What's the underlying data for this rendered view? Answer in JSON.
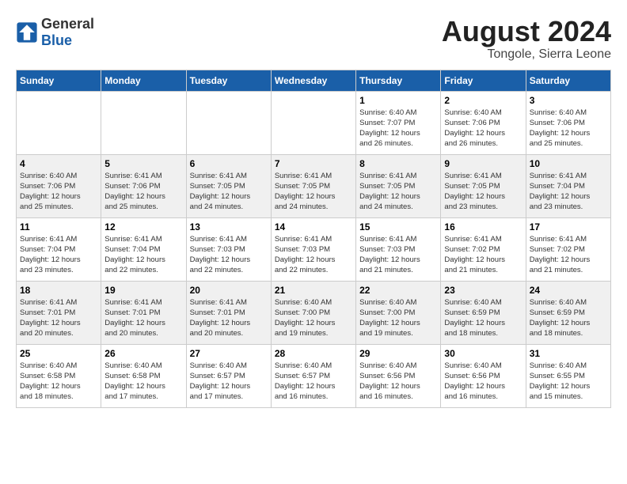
{
  "header": {
    "logo_general": "General",
    "logo_blue": "Blue",
    "month_year": "August 2024",
    "location": "Tongole, Sierra Leone"
  },
  "calendar": {
    "days_of_week": [
      "Sunday",
      "Monday",
      "Tuesday",
      "Wednesday",
      "Thursday",
      "Friday",
      "Saturday"
    ],
    "weeks": [
      [
        {
          "day": "",
          "info": ""
        },
        {
          "day": "",
          "info": ""
        },
        {
          "day": "",
          "info": ""
        },
        {
          "day": "",
          "info": ""
        },
        {
          "day": "1",
          "info": "Sunrise: 6:40 AM\nSunset: 7:07 PM\nDaylight: 12 hours\nand 26 minutes."
        },
        {
          "day": "2",
          "info": "Sunrise: 6:40 AM\nSunset: 7:06 PM\nDaylight: 12 hours\nand 26 minutes."
        },
        {
          "day": "3",
          "info": "Sunrise: 6:40 AM\nSunset: 7:06 PM\nDaylight: 12 hours\nand 25 minutes."
        }
      ],
      [
        {
          "day": "4",
          "info": "Sunrise: 6:40 AM\nSunset: 7:06 PM\nDaylight: 12 hours\nand 25 minutes."
        },
        {
          "day": "5",
          "info": "Sunrise: 6:41 AM\nSunset: 7:06 PM\nDaylight: 12 hours\nand 25 minutes."
        },
        {
          "day": "6",
          "info": "Sunrise: 6:41 AM\nSunset: 7:05 PM\nDaylight: 12 hours\nand 24 minutes."
        },
        {
          "day": "7",
          "info": "Sunrise: 6:41 AM\nSunset: 7:05 PM\nDaylight: 12 hours\nand 24 minutes."
        },
        {
          "day": "8",
          "info": "Sunrise: 6:41 AM\nSunset: 7:05 PM\nDaylight: 12 hours\nand 24 minutes."
        },
        {
          "day": "9",
          "info": "Sunrise: 6:41 AM\nSunset: 7:05 PM\nDaylight: 12 hours\nand 23 minutes."
        },
        {
          "day": "10",
          "info": "Sunrise: 6:41 AM\nSunset: 7:04 PM\nDaylight: 12 hours\nand 23 minutes."
        }
      ],
      [
        {
          "day": "11",
          "info": "Sunrise: 6:41 AM\nSunset: 7:04 PM\nDaylight: 12 hours\nand 23 minutes."
        },
        {
          "day": "12",
          "info": "Sunrise: 6:41 AM\nSunset: 7:04 PM\nDaylight: 12 hours\nand 22 minutes."
        },
        {
          "day": "13",
          "info": "Sunrise: 6:41 AM\nSunset: 7:03 PM\nDaylight: 12 hours\nand 22 minutes."
        },
        {
          "day": "14",
          "info": "Sunrise: 6:41 AM\nSunset: 7:03 PM\nDaylight: 12 hours\nand 22 minutes."
        },
        {
          "day": "15",
          "info": "Sunrise: 6:41 AM\nSunset: 7:03 PM\nDaylight: 12 hours\nand 21 minutes."
        },
        {
          "day": "16",
          "info": "Sunrise: 6:41 AM\nSunset: 7:02 PM\nDaylight: 12 hours\nand 21 minutes."
        },
        {
          "day": "17",
          "info": "Sunrise: 6:41 AM\nSunset: 7:02 PM\nDaylight: 12 hours\nand 21 minutes."
        }
      ],
      [
        {
          "day": "18",
          "info": "Sunrise: 6:41 AM\nSunset: 7:01 PM\nDaylight: 12 hours\nand 20 minutes."
        },
        {
          "day": "19",
          "info": "Sunrise: 6:41 AM\nSunset: 7:01 PM\nDaylight: 12 hours\nand 20 minutes."
        },
        {
          "day": "20",
          "info": "Sunrise: 6:41 AM\nSunset: 7:01 PM\nDaylight: 12 hours\nand 20 minutes."
        },
        {
          "day": "21",
          "info": "Sunrise: 6:40 AM\nSunset: 7:00 PM\nDaylight: 12 hours\nand 19 minutes."
        },
        {
          "day": "22",
          "info": "Sunrise: 6:40 AM\nSunset: 7:00 PM\nDaylight: 12 hours\nand 19 minutes."
        },
        {
          "day": "23",
          "info": "Sunrise: 6:40 AM\nSunset: 6:59 PM\nDaylight: 12 hours\nand 18 minutes."
        },
        {
          "day": "24",
          "info": "Sunrise: 6:40 AM\nSunset: 6:59 PM\nDaylight: 12 hours\nand 18 minutes."
        }
      ],
      [
        {
          "day": "25",
          "info": "Sunrise: 6:40 AM\nSunset: 6:58 PM\nDaylight: 12 hours\nand 18 minutes."
        },
        {
          "day": "26",
          "info": "Sunrise: 6:40 AM\nSunset: 6:58 PM\nDaylight: 12 hours\nand 17 minutes."
        },
        {
          "day": "27",
          "info": "Sunrise: 6:40 AM\nSunset: 6:57 PM\nDaylight: 12 hours\nand 17 minutes."
        },
        {
          "day": "28",
          "info": "Sunrise: 6:40 AM\nSunset: 6:57 PM\nDaylight: 12 hours\nand 16 minutes."
        },
        {
          "day": "29",
          "info": "Sunrise: 6:40 AM\nSunset: 6:56 PM\nDaylight: 12 hours\nand 16 minutes."
        },
        {
          "day": "30",
          "info": "Sunrise: 6:40 AM\nSunset: 6:56 PM\nDaylight: 12 hours\nand 16 minutes."
        },
        {
          "day": "31",
          "info": "Sunrise: 6:40 AM\nSunset: 6:55 PM\nDaylight: 12 hours\nand 15 minutes."
        }
      ]
    ]
  }
}
